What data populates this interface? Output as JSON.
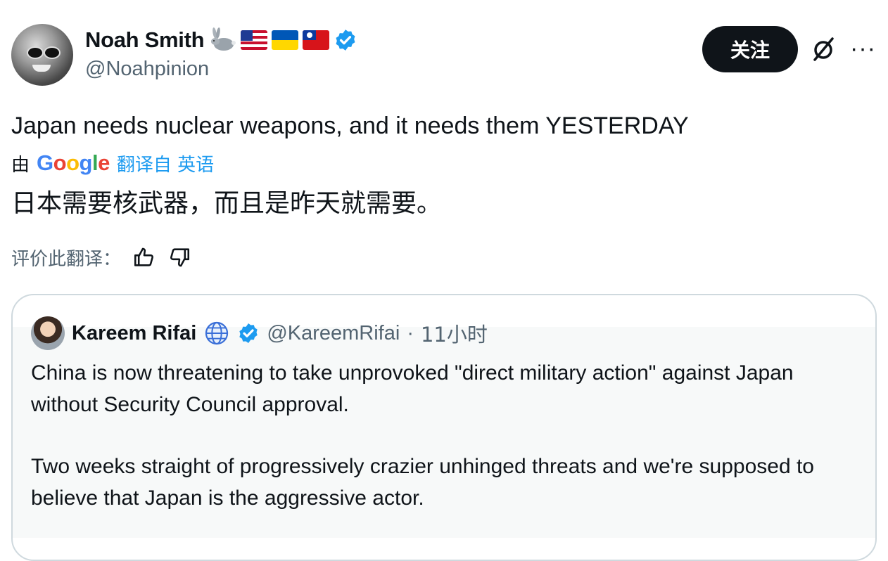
{
  "author": {
    "name": "Noah Smith",
    "handle": "@Noahpinion",
    "badges": [
      "rabbit-emoji",
      "flag-united-states",
      "flag-ukraine",
      "flag-taiwan",
      "verified-badge"
    ]
  },
  "actions": {
    "follow_label": "关注",
    "more_label": "···"
  },
  "tweet": {
    "text": "Japan needs nuclear weapons, and it needs them YESTERDAY",
    "translated_by_prefix": "由",
    "translator_logo": "Google",
    "translate_link": "翻译自 英语",
    "translated_text": "日本需要核武器，而且是昨天就需要。",
    "rate_label": "评价此翻译："
  },
  "quote": {
    "name": "Kareem Rifai",
    "handle": "@KareemRifai",
    "separator": "·",
    "time": "11小时",
    "paragraphs": [
      "China is now threatening to take unprovoked \"direct military action\" against Japan without Security Council approval.",
      "Two weeks straight of progressively crazier unhinged threats and we're supposed to believe that Japan is the aggressive actor."
    ]
  },
  "colors": {
    "text": "#0f1419",
    "secondary": "#536471",
    "link": "#1d9bf0",
    "verified": "#1d9bf0",
    "border": "#cfd9de"
  },
  "google_colors": [
    "#4285f4",
    "#ea4335",
    "#fbbc05",
    "#4285f4",
    "#34a853",
    "#ea4335"
  ]
}
